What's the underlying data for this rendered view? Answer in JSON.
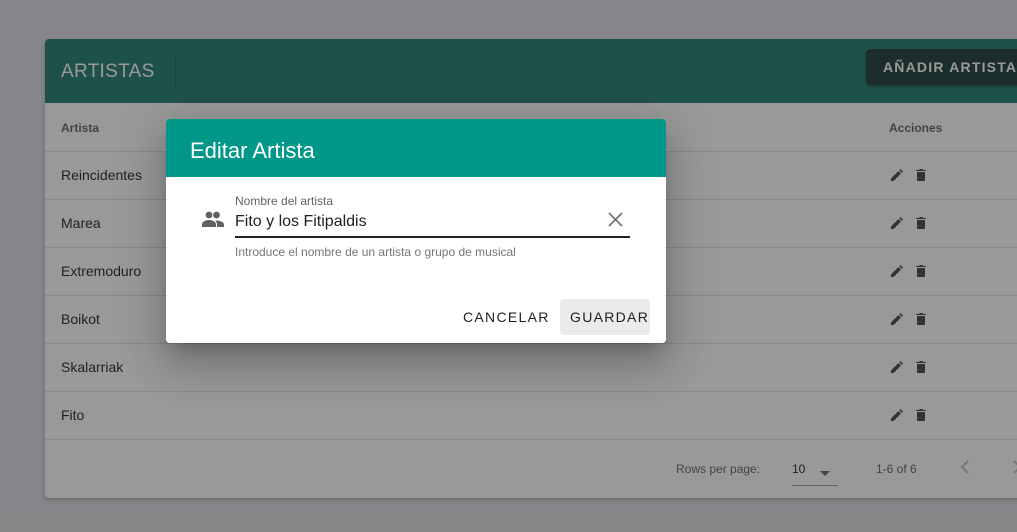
{
  "page": {
    "title": "ARTISTAS",
    "add_button": "AÑADIR ARTISTA"
  },
  "table": {
    "columns": {
      "artist": "Artista",
      "actions": "Acciones"
    },
    "rows": [
      {
        "name": "Reincidentes"
      },
      {
        "name": "Marea"
      },
      {
        "name": "Extremoduro"
      },
      {
        "name": "Boikot"
      },
      {
        "name": "Skalarriak"
      },
      {
        "name": "Fito"
      }
    ],
    "footer": {
      "rows_per_page_label": "Rows per page:",
      "rows_per_page_value": "10",
      "range": "1-6 of 6"
    }
  },
  "dialog": {
    "title": "Editar Artista",
    "field_label": "Nombre del artista",
    "field_value": "Fito y los Fitipaldis",
    "hint": "Introduce el nombre de un artista o grupo de musical",
    "cancel": "CANCELAR",
    "save": "GUARDAR"
  },
  "icons": {
    "row_actions": [
      "pencil-icon",
      "trash-icon"
    ],
    "field": "people-icon",
    "clear": "close-icon",
    "pagination": [
      "chevron-left-icon",
      "chevron-right-icon"
    ],
    "select": "caret-down-icon"
  },
  "colors": {
    "header": "#1e7b70",
    "dialog_header": "#009688",
    "add_button": "#173a36"
  }
}
